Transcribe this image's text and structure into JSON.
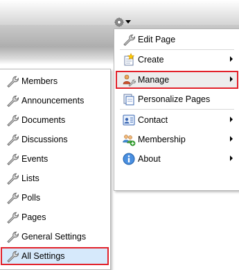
{
  "header": {
    "gear_icon": "gear-icon",
    "dropdown_icon": "chevron-down-icon"
  },
  "menu": {
    "items": [
      {
        "label": "Edit Page",
        "icon": "wrench-icon",
        "submenu": false
      },
      {
        "label": "Create",
        "icon": "create-icon",
        "submenu": true
      },
      {
        "label": "Manage",
        "icon": "manage-icon",
        "submenu": true,
        "selected": true
      },
      {
        "label": "Personalize Pages",
        "icon": "personalize-icon",
        "submenu": false
      },
      {
        "label": "Contact",
        "icon": "contact-icon",
        "submenu": true
      },
      {
        "label": "Membership",
        "icon": "membership-icon",
        "submenu": true
      },
      {
        "label": "About",
        "icon": "info-icon",
        "submenu": true
      }
    ]
  },
  "submenu": {
    "items": [
      {
        "label": "Members"
      },
      {
        "label": "Announcements"
      },
      {
        "label": "Documents"
      },
      {
        "label": "Discussions"
      },
      {
        "label": "Events"
      },
      {
        "label": "Lists"
      },
      {
        "label": "Polls"
      },
      {
        "label": "Pages"
      },
      {
        "label": "General Settings"
      },
      {
        "label": "All Settings",
        "selected": true
      }
    ]
  },
  "colors": {
    "highlight_outline": "#e2212a",
    "selected_background": "#d6e9fb"
  }
}
